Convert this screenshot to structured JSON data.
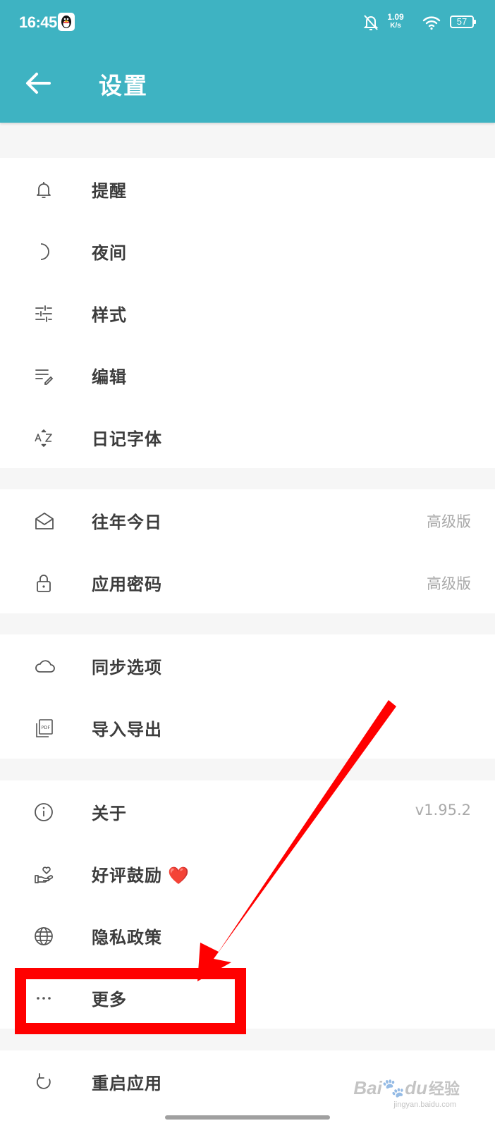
{
  "status_bar": {
    "time": "16:45",
    "speed_value": "1.09",
    "speed_unit": "K/s",
    "battery": "57",
    "icons": [
      "qq-penguin-icon",
      "bell-off-icon",
      "wifi-icon",
      "battery-icon"
    ]
  },
  "header": {
    "title": "设置",
    "back_icon": "arrow-left-icon",
    "color": "#3eb3c2"
  },
  "sections": [
    {
      "items": [
        {
          "icon": "bell-icon",
          "label": "提醒"
        },
        {
          "icon": "moon-icon",
          "label": "夜间"
        },
        {
          "icon": "sliders-icon",
          "label": "样式"
        },
        {
          "icon": "edit-list-icon",
          "label": "编辑"
        },
        {
          "icon": "az-sort-icon",
          "label": "日记字体"
        }
      ]
    },
    {
      "items": [
        {
          "icon": "envelope-open-icon",
          "label": "往年今日",
          "value": "高级版"
        },
        {
          "icon": "lock-icon",
          "label": "应用密码",
          "value": "高级版"
        }
      ]
    },
    {
      "items": [
        {
          "icon": "cloud-icon",
          "label": "同步选项"
        },
        {
          "icon": "pdf-icon",
          "label": "导入导出"
        }
      ]
    },
    {
      "items": [
        {
          "icon": "info-icon",
          "label": "关于",
          "value": "v1.95.2"
        },
        {
          "icon": "heart-hand-icon",
          "label": "好评鼓励",
          "emoji": "❤️"
        },
        {
          "icon": "globe-icon",
          "label": "隐私政策"
        },
        {
          "icon": "more-dots-icon",
          "label": "更多"
        }
      ]
    },
    {
      "items": [
        {
          "icon": "restart-icon",
          "label": "重启应用"
        }
      ]
    }
  ],
  "annotation": {
    "color": "#ff0000",
    "highlighted_item": "更多"
  },
  "watermark": {
    "brand": "Bai",
    "brand2": "du",
    "cn": "经验",
    "url": "jingyan.baidu.com"
  }
}
